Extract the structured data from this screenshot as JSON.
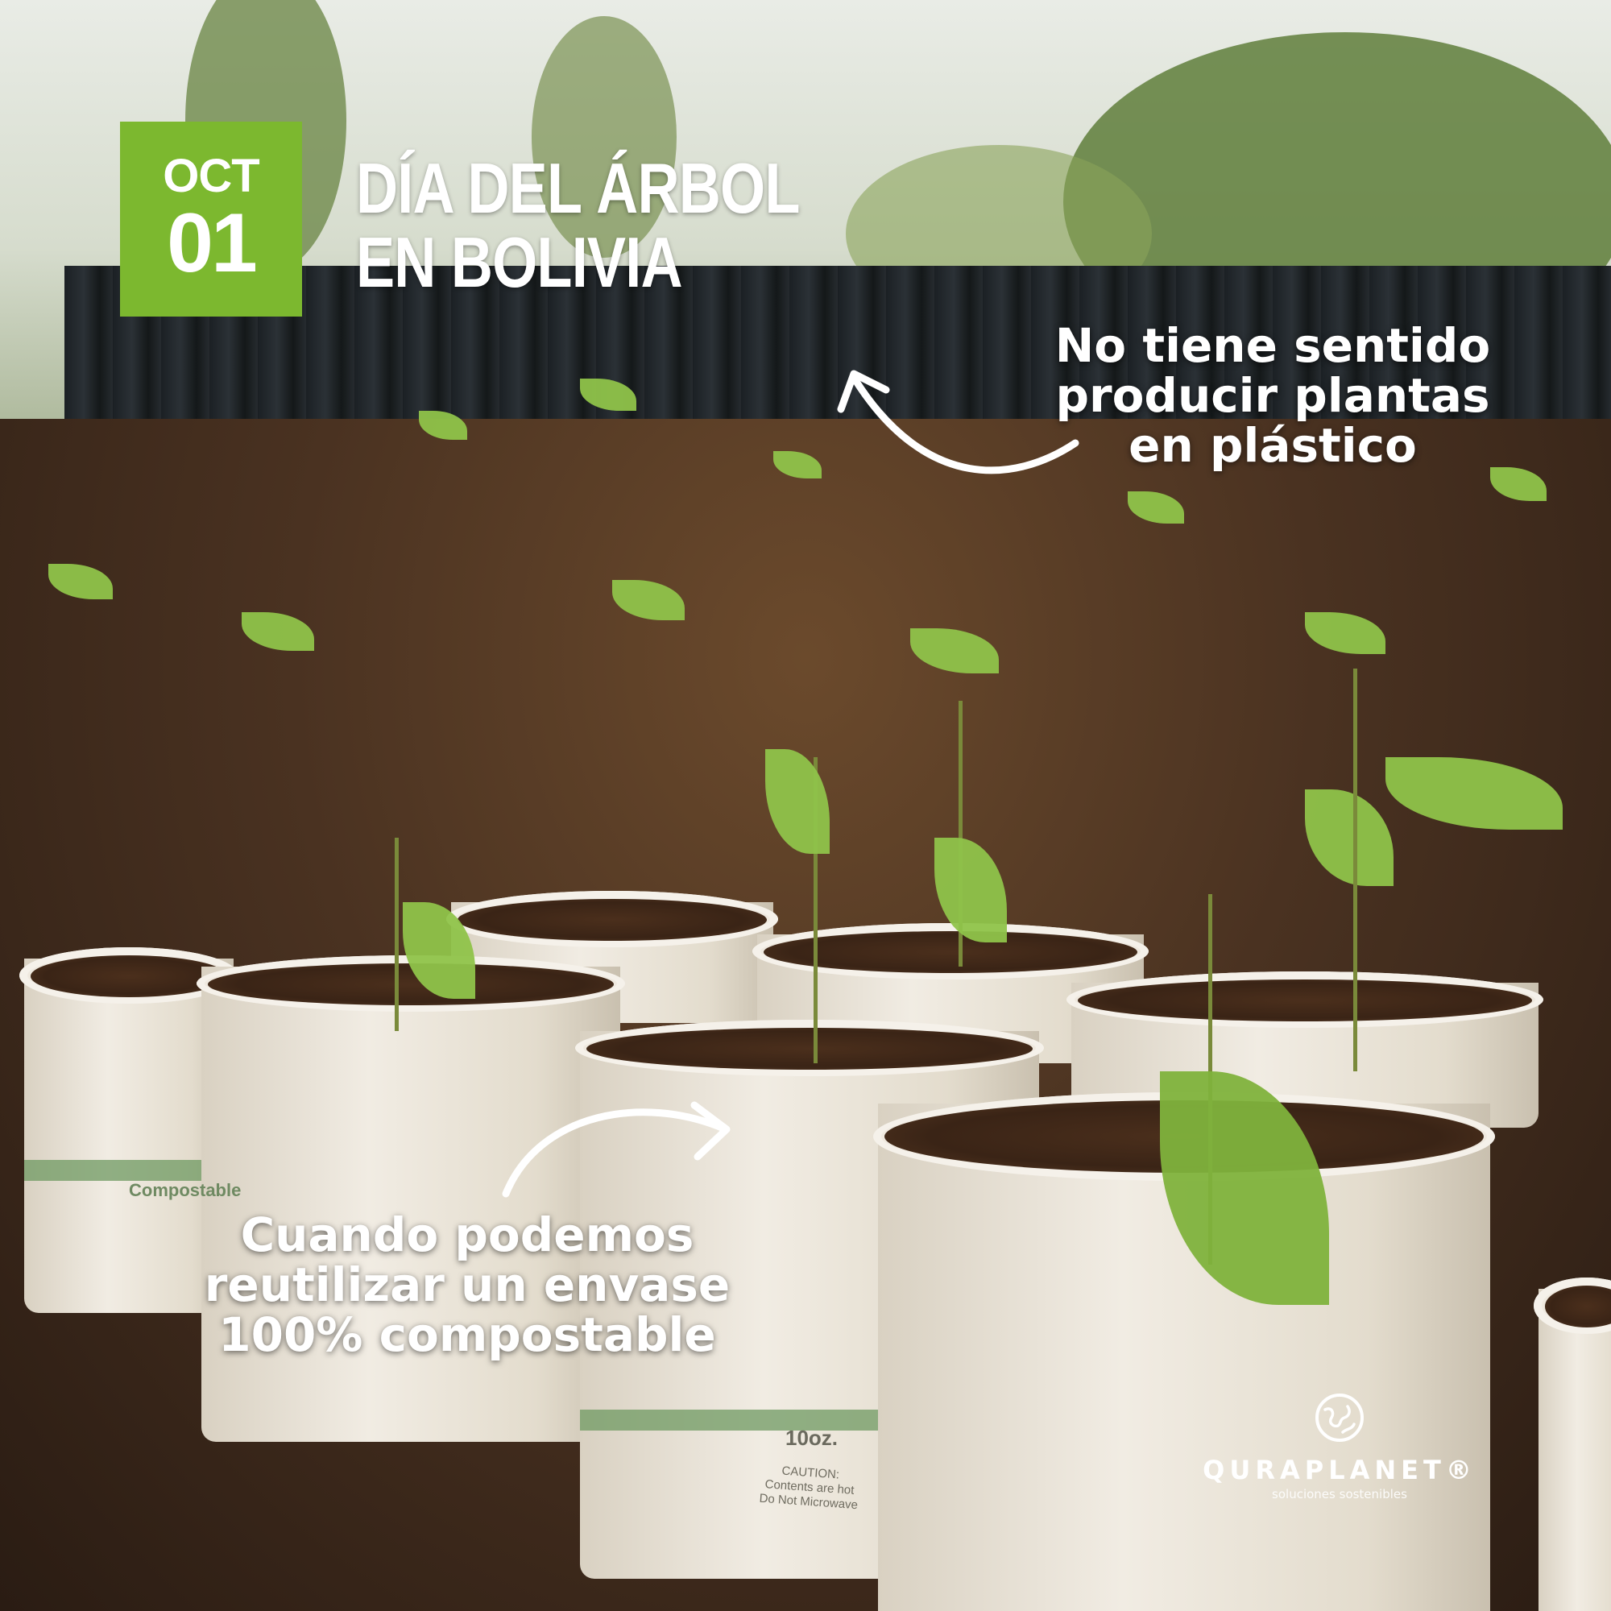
{
  "badge": {
    "month": "OCT",
    "day": "01",
    "color": "#7cb82f"
  },
  "headline": {
    "line1": "DÍA DEL ÁRBOL",
    "line2": "EN BOLIVIA"
  },
  "callout_top": {
    "line1": "No tiene sentido",
    "line2": "producir plantas",
    "line3": "en plástico"
  },
  "callout_bottom": {
    "line1": "Cuando podemos",
    "line2": "reutilizar un envase",
    "line3": "100% compostable"
  },
  "brand": {
    "name": "QURAPLANET®",
    "tagline": "soluciones sostenibles",
    "icon": "globe-icon"
  },
  "cup_print": {
    "size": "10oz.",
    "warning_line1": "CAUTION:",
    "warning_line2": "Contents are hot",
    "warning_line3": "Do Not Microwave",
    "label": "Compostable"
  }
}
